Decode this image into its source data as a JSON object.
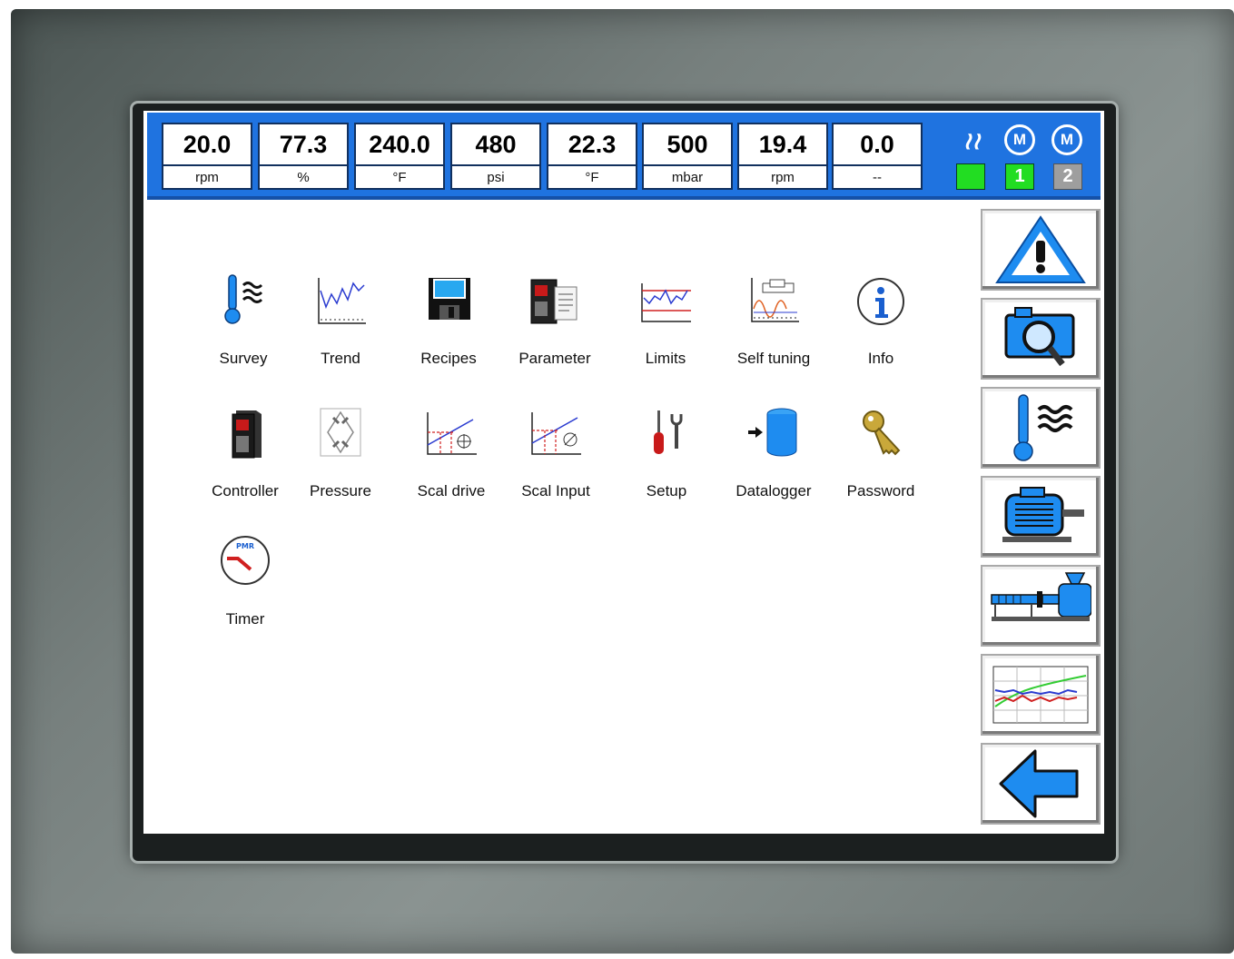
{
  "gauges": [
    {
      "value": "20.0",
      "unit": "rpm"
    },
    {
      "value": "77.3",
      "unit": "%"
    },
    {
      "value": "240.0",
      "unit": "°F"
    },
    {
      "value": "480",
      "unit": "psi"
    },
    {
      "value": "22.3",
      "unit": "°F"
    },
    {
      "value": "500",
      "unit": "mbar"
    },
    {
      "value": "19.4",
      "unit": "rpm"
    },
    {
      "value": "0.0",
      "unit": "--"
    }
  ],
  "status": {
    "heat_symbol": "≀≀",
    "motor1_symbol": "M",
    "motor2_symbol": "M",
    "box1_label": "",
    "box2_label": "1",
    "box3_label": "2",
    "colors": {
      "active": "#22dd22",
      "inactive": "#9e9e9e"
    }
  },
  "menu": {
    "survey": "Survey",
    "trend": "Trend",
    "recipes": "Recipes",
    "parameter": "Parameter",
    "limits": "Limits",
    "self_tuning": "Self tuning",
    "info": "Info",
    "controller": "Controller",
    "pressure": "Pressure",
    "scal_drive": "Scal drive",
    "scal_input": "Scal Input",
    "setup": "Setup",
    "datalogger": "Datalogger",
    "password": "Password",
    "timer": "Timer",
    "timer_icon_text": "PMR"
  },
  "sidebar_icons": [
    "warning-icon",
    "camera-zoom-icon",
    "thermometer-icon",
    "motor-icon",
    "extruder-icon",
    "trend-chart-icon",
    "back-arrow-icon"
  ],
  "colors": {
    "header_blue": "#1f73e0",
    "icon_blue": "#1e8cf0"
  }
}
